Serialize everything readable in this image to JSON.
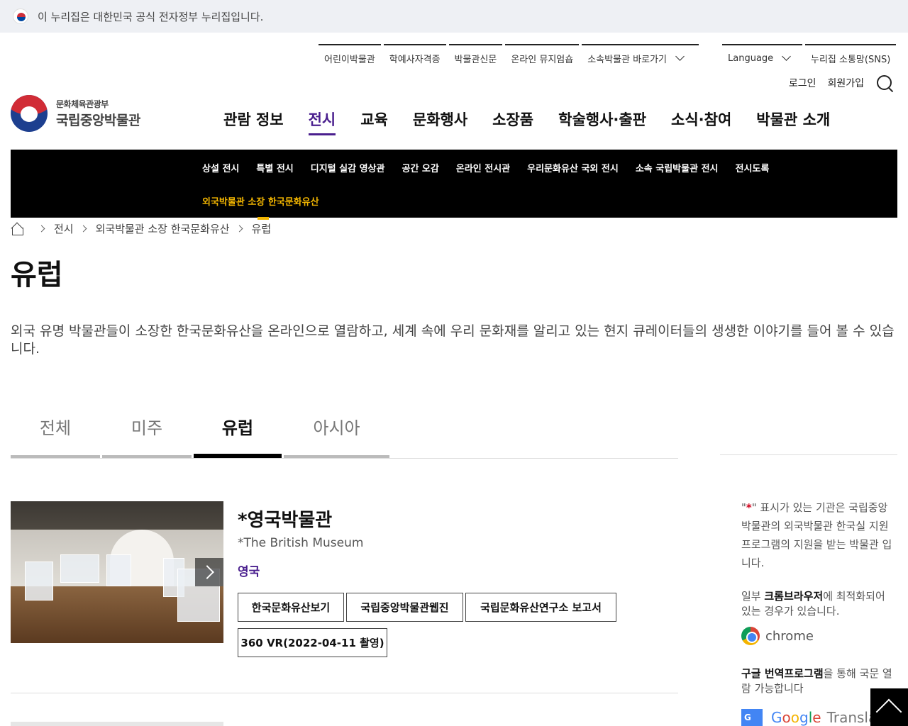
{
  "gov_banner": {
    "text": "이 누리집은 대한민국 공식 전자정부 누리집입니다."
  },
  "util_nav": {
    "items": [
      "어린이박물관",
      "학예사자격증",
      "박물관신문",
      "온라인 뮤지엄숍",
      "소속박물관 바로가기"
    ],
    "language": "Language",
    "sns": "누리집 소통망(SNS)"
  },
  "auth": {
    "login": "로그인",
    "signup": "회원가입"
  },
  "logo": {
    "sub": "문화체육관광부",
    "main": "국립중앙박물관"
  },
  "gnb": {
    "items": [
      "관람 정보",
      "전시",
      "교육",
      "문화행사",
      "소장품",
      "학술행사·출판",
      "소식·참여",
      "박물관 소개"
    ],
    "active": "전시"
  },
  "subnav": {
    "row1": [
      "상설 전시",
      "특별 전시",
      "디지털 실감 영상관",
      "공간 오감",
      "온라인 전시관",
      "우리문화유산 국외 전시",
      "소속 국립박물관 전시",
      "전시도록"
    ],
    "row2": [
      "외국박물관 소장 한국문화유산"
    ]
  },
  "breadcrumb": {
    "items": [
      "전시",
      "외국박물관 소장 한국문화유산",
      "유럽"
    ]
  },
  "page": {
    "title": "유럽",
    "description": "외국 유명 박물관들이 소장한 한국문화유산을 온라인으로 열람하고, 세계 속에 우리 문화재를 알리고 있는 현지 큐레이터들의 생생한 이야기를 들어 볼 수 있습니다."
  },
  "tabs": {
    "items": [
      "전체",
      "미주",
      "유럽",
      "아시아"
    ],
    "active": "유럽"
  },
  "museum": {
    "title": "*영국박물관",
    "english": "*The British Museum",
    "country": "영국",
    "buttons": [
      "한국문화유산보기",
      "국립중앙박물관웹진",
      "국립문화유산연구소 보고서",
      "360 VR(2022-04-11 촬영)"
    ]
  },
  "side": {
    "note_prefix": "\"",
    "note_star": "*",
    "note_text": "\" 표시가 있는 기관은 국립중앙박물관의 외국박물관 한국실 지원 프로그램의 지원을 받는 박물관 입니다.",
    "browser_a": "일부 ",
    "browser_bold": "크롬브라우저",
    "browser_b": "에 최적화되어 있는 경우가 있습니다.",
    "chrome_label": "chrome",
    "translate_bold": "구글 번역프로그램",
    "translate_rest": "을 통해 국문 열람 가능합니다",
    "google_letters": [
      "G",
      "o",
      "o",
      "g",
      "l",
      "e"
    ],
    "translate_label": "Translate",
    "gt_icon_label": "G"
  },
  "colors": {
    "brand_purple": "#4a1f8e",
    "subnav_active": "#f3b600",
    "subnav_bg": "#000000"
  }
}
